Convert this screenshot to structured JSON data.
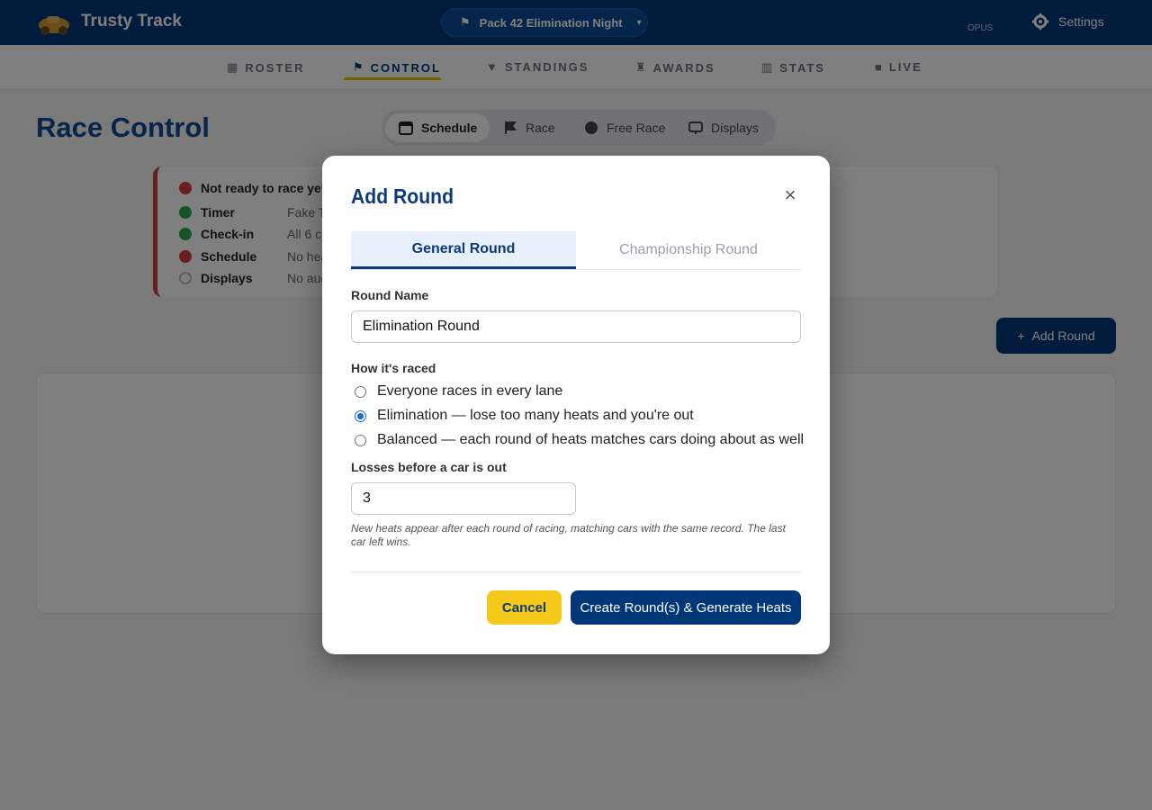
{
  "header": {
    "app_title": "Trusty Track",
    "event_selector": "Pack 42 Elimination Night",
    "user_tag": "OPUS",
    "settings_label": "Settings"
  },
  "nav": {
    "items": [
      {
        "label": "ROSTER",
        "icon": "roster-icon"
      },
      {
        "label": "CONTROL",
        "icon": "flag-icon"
      },
      {
        "label": "STANDINGS",
        "icon": "trophy-icon"
      },
      {
        "label": "AWARDS",
        "icon": "medal-icon"
      },
      {
        "label": "STATS",
        "icon": "chart-icon"
      },
      {
        "label": "LIVE",
        "icon": "video-icon"
      }
    ],
    "active": "CONTROL"
  },
  "page": {
    "title": "Race Control",
    "segments": [
      {
        "label": "Schedule",
        "icon": "calendar-icon"
      },
      {
        "label": "Race",
        "icon": "flag-icon"
      },
      {
        "label": "Free Race",
        "icon": "car-icon"
      },
      {
        "label": "Displays",
        "icon": "monitor-icon"
      }
    ],
    "active_segment": "Schedule",
    "add_round_label": "Add Round"
  },
  "status": {
    "headline": "Not ready to race yet",
    "rows": [
      {
        "label": "Timer",
        "detail": "Fake T",
        "state": "ok"
      },
      {
        "label": "Check-in",
        "detail": "All 6 c",
        "state": "ok"
      },
      {
        "label": "Schedule",
        "detail": "No hea",
        "state": "error"
      },
      {
        "label": "Displays",
        "detail": "No aud",
        "state": "none"
      }
    ]
  },
  "modal": {
    "title": "Add Round",
    "close_label": "×",
    "tabs": [
      "General Round",
      "Championship Round"
    ],
    "active_tab": "General Round",
    "round_name_label": "Round Name",
    "round_name_value": "Elimination Round",
    "how_label": "How it's raced",
    "options": [
      {
        "label": "Everyone races in every lane",
        "checked": false
      },
      {
        "label": "Elimination — lose too many heats and you're out",
        "checked": true
      },
      {
        "label": "Balanced — each round of heats matches cars doing about as well",
        "checked": false
      }
    ],
    "losses_label": "Losses before a car is out",
    "losses_value": "3",
    "hint": "New heats appear after each round of racing, matching cars with the same record. The last car left wins.",
    "cancel_label": "Cancel",
    "create_label": "Create Round(s) & Generate Heats"
  },
  "colors": {
    "brand_navy": "#003778",
    "accent_yellow": "#f5c91a",
    "status_red": "#d43c3c",
    "status_green": "#2fa84f",
    "radio_blue": "#1a6ad6"
  }
}
